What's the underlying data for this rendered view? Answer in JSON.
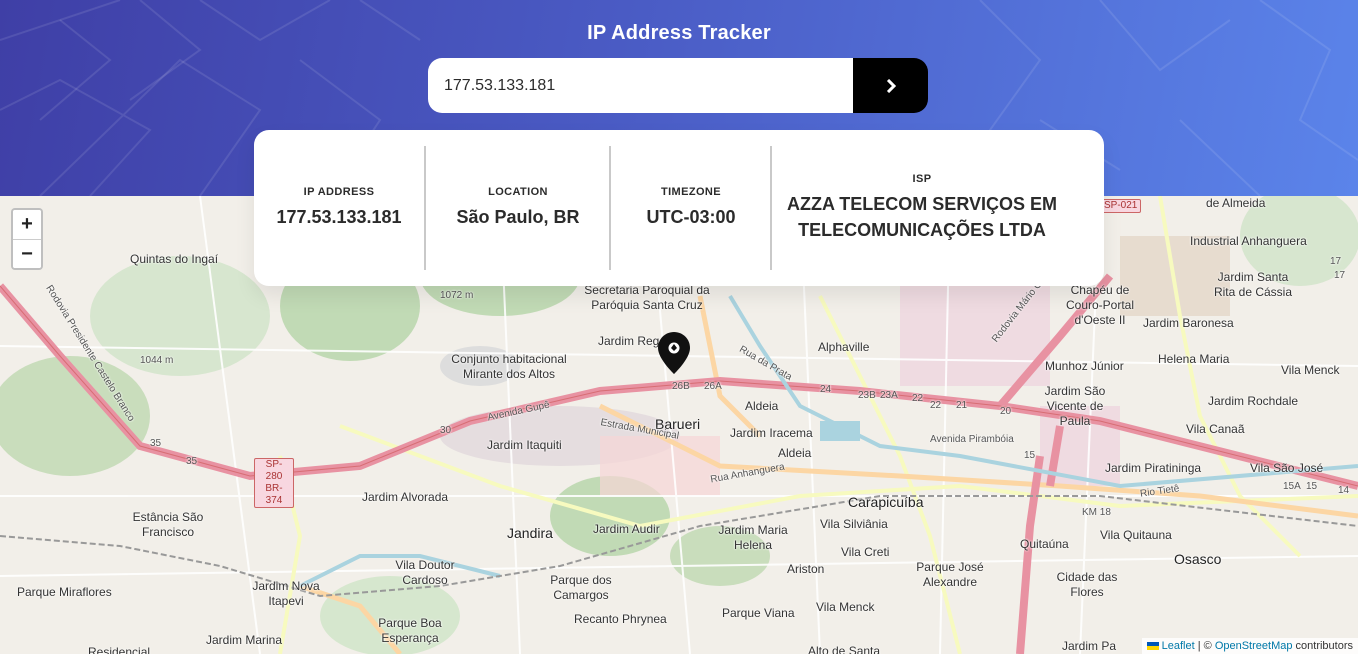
{
  "app": {
    "title": "IP Address Tracker"
  },
  "search": {
    "value": "177.53.133.181",
    "submit_icon": "chevron-right-icon"
  },
  "info": {
    "ip": {
      "label": "IP ADDRESS",
      "value": "177.53.133.181"
    },
    "location": {
      "label": "LOCATION",
      "value": "São Paulo, BR"
    },
    "timezone": {
      "label": "TIMEZONE",
      "value": "UTC-03:00"
    },
    "isp": {
      "label": "ISP",
      "value": "AZZA TELECOM SERVIÇOS EM TELECOMUNICAÇÕES LTDA"
    }
  },
  "map": {
    "zoom_in": "+",
    "zoom_out": "−",
    "attribution": {
      "leaflet": "Leaflet",
      "separator": " | © ",
      "osm": "OpenStreetMap",
      "suffix": " contributors"
    },
    "places": {
      "quintas": "Quintas do Ingaí",
      "secretaria": "Secretaria Paroquial da Paróquia Santa Cruz",
      "jardim_regente": "Jardim Regente",
      "conjunto": "Conjunto habitacional Mirante dos Altos",
      "alphaville": "Alphaville",
      "barueri": "Barueri",
      "aldeia1": "Aldeia",
      "aldeia2": "Aldeia",
      "jardim_itaquiti": "Jardim Itaquiti",
      "jardim_iracema": "Jardim Iracema",
      "jardim_alvorada": "Jardim Alvorada",
      "estancia": "Estância São Francisco",
      "jandira": "Jandira",
      "jardim_audir": "Jardim Audir",
      "jardim_maria_helena": "Jardim Maria Helena",
      "carapicuiba": "Carapicuíba",
      "vila_silviania": "Vila Silviânia",
      "vila_creti": "Vila Creti",
      "aristo": "Ariston",
      "parque_jose": "Parque José Alexandre",
      "vila_menck1": "Vila Menck",
      "vila_doutor": "Vila Doutor Cardoso",
      "parque_camargos": "Parque dos Camargos",
      "jardim_nova": "Jardim Nova Itapevi",
      "parque_miraflores": "Parque Miraflores",
      "jardim_marina": "Jardim Marina",
      "parque_boa": "Parque Boa Esperança",
      "recanto": "Recanto Phrynea",
      "parque_viana": "Parque Viana",
      "alto_santa": "Alto de Santa",
      "residencial": "Residencial",
      "jardim_almeida": "de Almeida",
      "industrial": "Industrial Anhanguera",
      "jardim_santa_rita": "Jardim Santa Rita de Cássia",
      "chapeu": "Chapéu de Couro-Portal d'Oeste II",
      "jardim_baronesa": "Jardim Baronesa",
      "munhoz": "Munhoz Júnior",
      "helena_maria": "Helena Maria",
      "vila_menck2": "Vila Menck",
      "jardim_sao_vicente": "Jardim São Vicente de Paula",
      "jardim_rochdale": "Jardim Rochdale",
      "vila_canaa": "Vila Canaã",
      "jardim_piratininga": "Jardim Piratininga",
      "vila_sao_jose": "Vila São José",
      "quitauna": "Quitaúna",
      "vila_quitauna": "Vila Quitauna",
      "osasco": "Osasco",
      "cidade_flores": "Cidade das Flores",
      "jardim_pa": "Jardim Pa",
      "km18": "KM 18",
      "elev1": "1072 m",
      "elev2": "1044 m",
      "avenida_gupe": "Avenida Gupê",
      "estrada_municipal": "Estrada Municipal",
      "rua_anhanguera": "Rua Anhanguera",
      "avenida_piramboia": "Avenida Pirambóia",
      "rodovia_castelo": "Rodovia Presidente Castelo Branco",
      "rua_da_prata": "Rua da Prata",
      "rodovia_covas": "Rodovia Mário Covas",
      "rio_tiete": "Rio Tietê"
    },
    "shields": {
      "sp280": "SP-280 BR-374",
      "sp021": "SP-021"
    },
    "markers": {
      "n35a": "35",
      "n35b": "35",
      "n30": "30",
      "n26b": "26B",
      "n26a": "26A",
      "n24": "24",
      "n23b": "23B",
      "n23a": "23A",
      "n22a": "22",
      "n22b": "22",
      "n21": "21",
      "n20": "20",
      "n15": "15",
      "n15a": "15A",
      "n15b": "15",
      "n14": "14",
      "n17a": "17",
      "n17b": "17"
    }
  },
  "colors": {
    "header_start": "#3f3fa6",
    "header_end": "#5b84ea",
    "button": "#000000",
    "text": "#2b2b2b",
    "highway": "#e892a2"
  }
}
